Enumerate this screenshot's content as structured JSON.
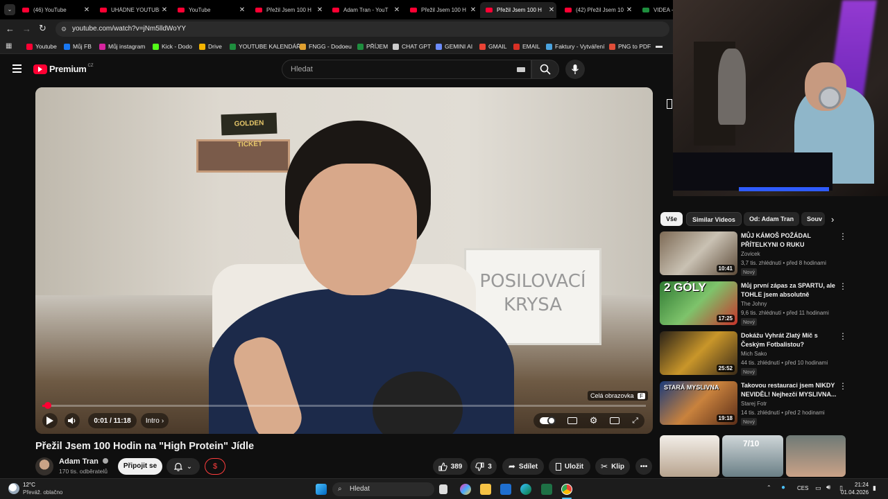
{
  "browser": {
    "tabs": [
      {
        "title": "(46) YouTube",
        "active": false
      },
      {
        "title": "UHÁDNE YOUTUBERA",
        "active": false
      },
      {
        "title": "YouTube",
        "active": false
      },
      {
        "title": "Přežil Jsem 100 H",
        "active": false
      },
      {
        "title": "Adam Tran - YouT",
        "active": false
      },
      {
        "title": "Přežil Jsem 100 H",
        "active": false
      },
      {
        "title": "Přežil Jsem 100 H",
        "active": true
      },
      {
        "title": "(42) Přežil Jsem 10",
        "active": false
      },
      {
        "title": "VIDEA - D",
        "active": false
      }
    ],
    "url": "youtube.com/watch?v=jNm5lldWoYY",
    "bookmarks": [
      {
        "label": "Youtube",
        "color": "#ff0033"
      },
      {
        "label": "Můj FB",
        "color": "#1877f2"
      },
      {
        "label": "Můj instagram",
        "color": "#d6249f"
      },
      {
        "label": "Kick - Dodo",
        "color": "#53fc18"
      },
      {
        "label": "Drive",
        "color": "#f4b400"
      },
      {
        "label": "YOUTUBE KALENDÁŘ",
        "color": "#1e8e3e"
      },
      {
        "label": "FNGG - Dodoeu",
        "color": "#e0a030"
      },
      {
        "label": "PŘÍJEM",
        "color": "#1e8e3e"
      },
      {
        "label": "CHAT GPT",
        "color": "#cccccc"
      },
      {
        "label": "GEMINI AI",
        "color": "#6c8cff"
      },
      {
        "label": "GMAIL",
        "color": "#ea4335"
      },
      {
        "label": "EMAIL",
        "color": "#d93025"
      },
      {
        "label": "Faktury - Vytváření",
        "color": "#4aa3df"
      },
      {
        "label": "PNG to PDF",
        "color": "#e04e39"
      }
    ]
  },
  "youtube": {
    "logo_text": "Premium",
    "logo_region": "CZ",
    "search_placeholder": "Hledat"
  },
  "player": {
    "time": "0:01 / 11:18",
    "chapter": "Intro",
    "tooltip": "Celá obrazovka",
    "tooltip_key": "F",
    "progress_fraction": 0.01,
    "scene": {
      "sign_text": "GOLDEN TICKET",
      "board_text": "POSILOVACÍ KRYSA"
    }
  },
  "video": {
    "title": "Přežil Jsem 100 Hodin na \"High Protein\" Jídle",
    "channel": "Adam Tran",
    "subscribers": "170 tis. odběratelů",
    "join_label": "Připojit se",
    "likes": "389",
    "dislikes": "3",
    "share_label": "Sdílet",
    "save_label": "Uložit",
    "clip_label": "Klip"
  },
  "sidebar": {
    "chips": [
      "Vše",
      "Similar Videos",
      "Od: Adam Tran",
      "Souv"
    ],
    "recommendations": [
      {
        "title": "MŮJ KÁMOŠ POŽÁDAL PŘÍTELKYNI O RUKU",
        "channel": "Zovicek",
        "stats": "3,7 tis. zhlédnutí • před 8 hodinami",
        "badge": "Nový",
        "duration": "10:41"
      },
      {
        "title": "Můj první zápas za SPARTU, ale TOHLE jsem absolutně nečeka...",
        "channel": "The Johny",
        "stats": "9,6 tis. zhlédnutí • před 11 hodinami",
        "badge": "Nový",
        "duration": "17:25",
        "thumb_text": "2 GÓLY"
      },
      {
        "title": "Dokážu Vyhrát Zlatý Míč s Českým Fotbalistou?",
        "channel": "Mich Sako",
        "stats": "44 tis. zhlédnutí • před 10 hodinami",
        "badge": "Nový",
        "duration": "25:52"
      },
      {
        "title": "Takovou restauraci jsem NIKDY NEVIDĚL! Nejhezčí MYSLIVNA...",
        "channel": "Starej Fotr",
        "stats": "14 tis. zhlédnutí • před 2 hodinami",
        "badge": "Nový",
        "duration": "19:18",
        "thumb_text": "STARÁ MYSLIVNA"
      }
    ],
    "shorts_label": "7/10"
  },
  "taskbar": {
    "weather_temp": "12°C",
    "weather_desc": "Převáž. oblačno",
    "search_placeholder": "Hledat",
    "language": "CES",
    "time": "21:24",
    "date": "01.04.2026"
  }
}
